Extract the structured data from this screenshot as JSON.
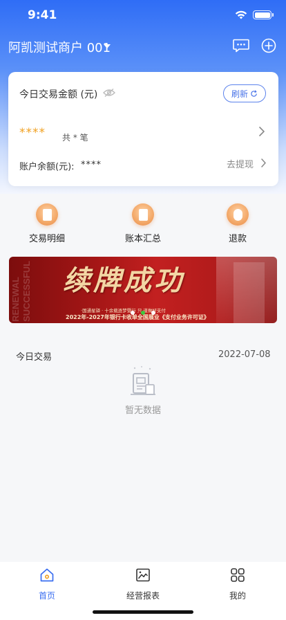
{
  "status_bar": {
    "time": "9:41"
  },
  "header": {
    "merchant_name": "阿凯测试商户 001",
    "message_icon": "message-icon",
    "add_icon": "plus-circle-icon"
  },
  "card": {
    "title": "今日交易金额 (元)",
    "refresh_label": "刷新",
    "amount_masked": "****",
    "count_text": "共 * 笔",
    "balance_label": "账户余额(元):",
    "balance_masked": "****",
    "withdraw_label": "去提现"
  },
  "quick_menu": {
    "items": [
      {
        "label": "交易明细",
        "icon": "receipt-icon"
      },
      {
        "label": "账本汇总",
        "icon": "ledger-icon"
      },
      {
        "label": "退款",
        "icon": "refund-icon"
      }
    ]
  },
  "banner": {
    "headline": "续牌成功",
    "side_text": "RENEWAL SUCCESSFUL",
    "subtitle_1": "·国通星驿 · 十余载逐梦暨行 只 道做好支付",
    "subtitle_2": "2022年-2027年银行卡收单全国展业《支付业务许可证》",
    "active_dot_color": "#3ec93e"
  },
  "today": {
    "label": "今日交易",
    "date": "2022-07-08",
    "empty_text": "暂无数据"
  },
  "tab_bar": {
    "tabs": [
      {
        "label": "首页",
        "icon": "home-icon",
        "active": true
      },
      {
        "label": "经营报表",
        "icon": "chart-image-icon",
        "active": false
      },
      {
        "label": "我的",
        "icon": "grid-icon",
        "active": false
      }
    ]
  },
  "colors": {
    "brand_blue": "#2f6df6",
    "accent_orange": "#f0a020",
    "tab_active": "#3a6ef0",
    "tab_inactive": "#333333"
  }
}
